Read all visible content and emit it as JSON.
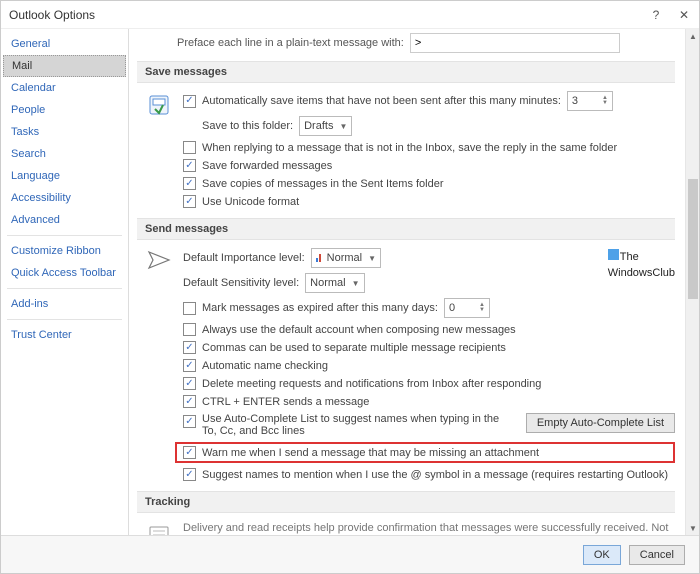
{
  "window": {
    "title": "Outlook Options"
  },
  "sidebar": {
    "items": [
      "General",
      "Mail",
      "Calendar",
      "People",
      "Tasks",
      "Search",
      "Language",
      "Accessibility",
      "Advanced"
    ],
    "items2": [
      "Customize Ribbon",
      "Quick Access Toolbar"
    ],
    "items3": [
      "Add-ins"
    ],
    "items4": [
      "Trust Center"
    ],
    "selected": "Mail"
  },
  "preface": {
    "label": "Preface each line in a plain-text message with:",
    "value": ">"
  },
  "save": {
    "head": "Save messages",
    "autosave_label": "Automatically save items that have not been sent after this many minutes:",
    "autosave_val": "3",
    "folder_label": "Save to this folder:",
    "folder_val": "Drafts",
    "reply": "When replying to a message that is not in the Inbox, save the reply in the same folder",
    "fwd": "Save forwarded messages",
    "sent": "Save copies of messages in the Sent Items folder",
    "unicode": "Use Unicode format"
  },
  "send": {
    "head": "Send messages",
    "importance_label": "Default Importance level:",
    "importance_val": "Normal",
    "sensitivity_label": "Default Sensitivity level:",
    "sensitivity_val": "Normal",
    "expire_label": "Mark messages as expired after this many days:",
    "expire_val": "0",
    "default_acct": "Always use the default account when composing new messages",
    "commas": "Commas can be used to separate multiple message recipients",
    "auto_name": "Automatic name checking",
    "del_meeting": "Delete meeting requests and notifications from Inbox after responding",
    "ctrl_enter": "CTRL + ENTER sends a message",
    "auto_complete": "Use Auto-Complete List to suggest names when typing in the To, Cc, and Bcc lines",
    "empty_btn": "Empty Auto-Complete List",
    "warn_attach": "Warn me when I send a message that may be missing an attachment",
    "suggest_names": "Suggest names to mention when I use the @ symbol in a message (requires restarting Outlook)"
  },
  "tracking": {
    "head": "Tracking",
    "desc": "Delivery and read receipts help provide confirmation that messages were successfully received. Not all email servers and applications support sending receipts."
  },
  "footer": {
    "ok": "OK",
    "cancel": "Cancel"
  },
  "watermark": {
    "l1": "The",
    "l2": "WindowsClub"
  }
}
